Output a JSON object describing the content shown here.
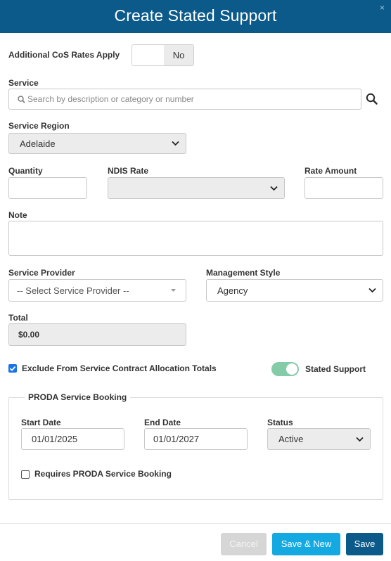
{
  "dialog": {
    "title": "Create Stated Support",
    "close_icon": "×"
  },
  "cos_rates": {
    "label": "Additional CoS Rates Apply",
    "value": "No"
  },
  "service": {
    "label": "Service",
    "placeholder": "Search by description or category or number"
  },
  "service_region": {
    "label": "Service Region",
    "value": "Adelaide"
  },
  "quantity": {
    "label": "Quantity",
    "value": ""
  },
  "ndis_rate": {
    "label": "NDIS Rate",
    "value": ""
  },
  "rate_amount": {
    "label": "Rate Amount",
    "value": ""
  },
  "note": {
    "label": "Note",
    "value": ""
  },
  "service_provider": {
    "label": "Service Provider",
    "placeholder": "-- Select Service Provider --"
  },
  "management_style": {
    "label": "Management Style",
    "value": "Agency"
  },
  "total": {
    "label": "Total",
    "value": "$0.00"
  },
  "exclude_allocation": {
    "label": "Exclude From Service Contract Allocation Totals",
    "checked": true
  },
  "stated_support": {
    "label": "Stated Support",
    "on": true
  },
  "proda": {
    "legend": "PRODA Service Booking",
    "start_date": {
      "label": "Start Date",
      "value": "01/01/2025"
    },
    "end_date": {
      "label": "End Date",
      "value": "01/01/2027"
    },
    "status": {
      "label": "Status",
      "value": "Active"
    },
    "requires": {
      "label": "Requires PRODA Service Booking",
      "checked": false
    }
  },
  "buttons": {
    "cancel": "Cancel",
    "save_new": "Save & New",
    "save": "Save"
  },
  "colors": {
    "header": "#0b5a8a",
    "save_new": "#15a9e1",
    "save": "#0b5a8a",
    "toggle_on": "#84cba8",
    "checkbox": "#1a73e8"
  }
}
